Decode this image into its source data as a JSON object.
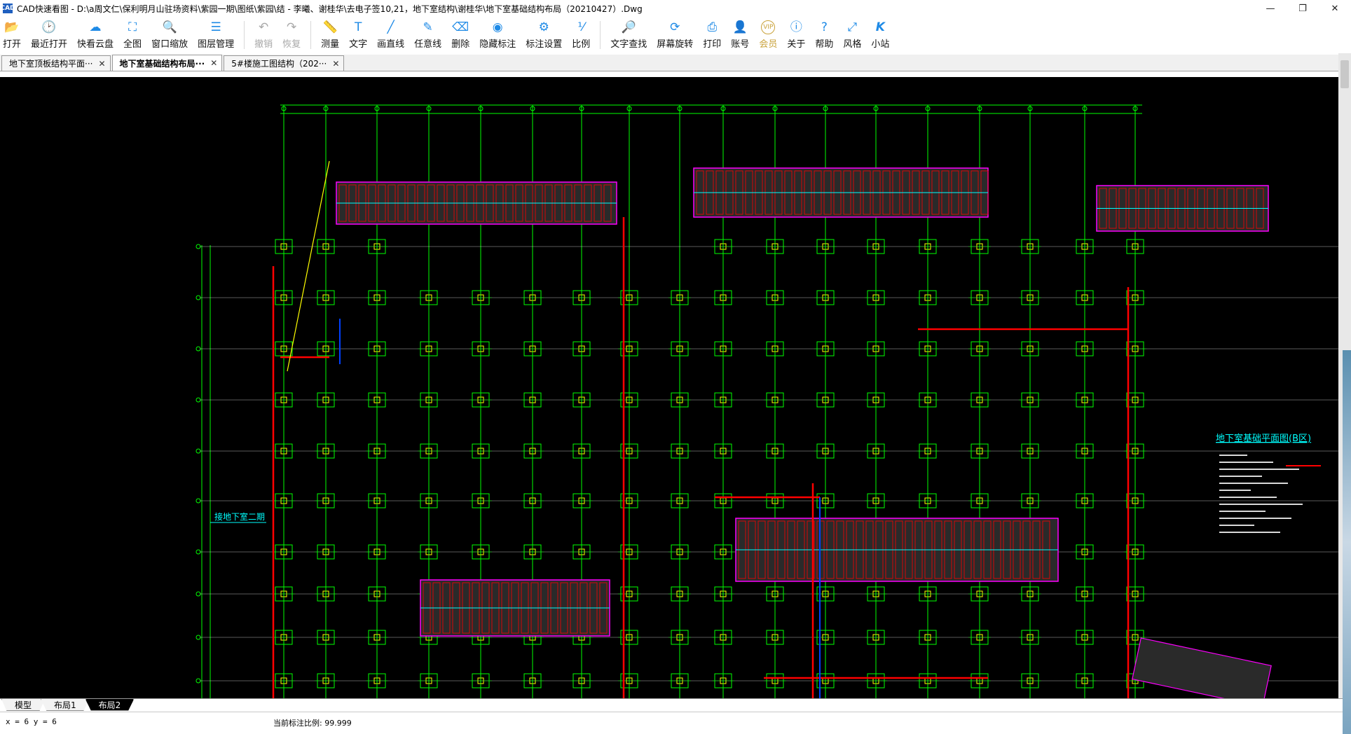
{
  "window": {
    "app_icon": "CAD",
    "title": "CAD快速看图 - D:\\a周文仁\\保利明月山驻场资料\\紫园一期\\图纸\\紫园\\结 - 李曦、谢桂华\\去电子签10,21，地下室结构\\谢桂华\\地下室基础结构布局（20210427）.Dwg",
    "controls": {
      "minimize": "—",
      "maximize": "❐",
      "close": "✕"
    }
  },
  "toolbar": {
    "items": [
      {
        "label": "打开",
        "icon": "folder-open-icon",
        "glyph": "📂",
        "enabled": true
      },
      {
        "label": "最近打开",
        "icon": "recent-clock-icon",
        "glyph": "🕑",
        "enabled": true
      },
      {
        "label": "快看云盘",
        "icon": "cloud-icon",
        "glyph": "☁",
        "enabled": true
      },
      {
        "label": "全图",
        "icon": "full-extent-icon",
        "glyph": "⛶",
        "enabled": true
      },
      {
        "label": "窗口缩放",
        "icon": "zoom-window-icon",
        "glyph": "🔍",
        "enabled": true
      },
      {
        "label": "图层管理",
        "icon": "layers-icon",
        "glyph": "☰",
        "enabled": true
      },
      {
        "label": "撤销",
        "icon": "undo-icon",
        "glyph": "↶",
        "enabled": false
      },
      {
        "label": "恢复",
        "icon": "redo-icon",
        "glyph": "↷",
        "enabled": false
      },
      {
        "label": "测量",
        "icon": "ruler-icon",
        "glyph": "📏",
        "enabled": true
      },
      {
        "label": "文字",
        "icon": "text-tool-icon",
        "glyph": "T",
        "enabled": true
      },
      {
        "label": "画直线",
        "icon": "line-tool-icon",
        "glyph": "╱",
        "enabled": true
      },
      {
        "label": "任意线",
        "icon": "freehand-pen-icon",
        "glyph": "✎",
        "enabled": true
      },
      {
        "label": "删除",
        "icon": "eraser-icon",
        "glyph": "⌫",
        "enabled": true
      },
      {
        "label": "隐藏标注",
        "icon": "hide-eye-icon",
        "glyph": "◉",
        "enabled": true
      },
      {
        "label": "标注设置",
        "icon": "annotation-settings-icon",
        "glyph": "⚙",
        "enabled": true
      },
      {
        "label": "比例",
        "icon": "scale-ratio-icon",
        "glyph": "⅟",
        "enabled": true
      },
      {
        "label": "文字查找",
        "icon": "text-search-icon",
        "glyph": "🔎",
        "enabled": true
      },
      {
        "label": "屏幕旋转",
        "icon": "rotate-screen-icon",
        "glyph": "⟳",
        "enabled": true
      },
      {
        "label": "打印",
        "icon": "printer-icon",
        "glyph": "⎙",
        "enabled": true
      },
      {
        "label": "账号",
        "icon": "account-user-icon",
        "glyph": "👤",
        "enabled": true
      },
      {
        "label": "会员",
        "icon": "vip-badge-icon",
        "glyph": "VIP",
        "enabled": true,
        "vip": true
      },
      {
        "label": "关于",
        "icon": "info-icon",
        "glyph": "ⓘ",
        "enabled": true
      },
      {
        "label": "帮助",
        "icon": "help-question-icon",
        "glyph": "?",
        "enabled": true
      },
      {
        "label": "风格",
        "icon": "style-theme-icon",
        "glyph": "⤢",
        "enabled": true
      },
      {
        "label": "小站",
        "icon": "kuaikan-k-icon",
        "glyph": "K",
        "enabled": true
      }
    ]
  },
  "tabs": [
    {
      "label": "地下室顶板结构平面···",
      "active": false,
      "close": "✕"
    },
    {
      "label": "地下室基础结构布局···",
      "active": true,
      "close": "✕"
    },
    {
      "label": "5#楼施工图结构（202···",
      "active": false,
      "close": "✕"
    }
  ],
  "drawing": {
    "background": "#000000",
    "legend_title": "地下室基础平面图(B区)",
    "side_label": "接地下室二期",
    "line_colors": {
      "grid": "#00ff00",
      "wall": "#ff0000",
      "column": "#ffff00",
      "accent_blue": "#0040ff",
      "accent_magenta": "#ff00ff",
      "accent_cyan": "#00ffff",
      "white": "#ffffff"
    }
  },
  "layout_tabs": [
    {
      "label": "模型",
      "active": false
    },
    {
      "label": "布局1",
      "active": false
    },
    {
      "label": "布局2",
      "active": true
    }
  ],
  "status": {
    "coords": "x = 6 y = 6",
    "scale_text": "当前标注比例: 99.999"
  }
}
